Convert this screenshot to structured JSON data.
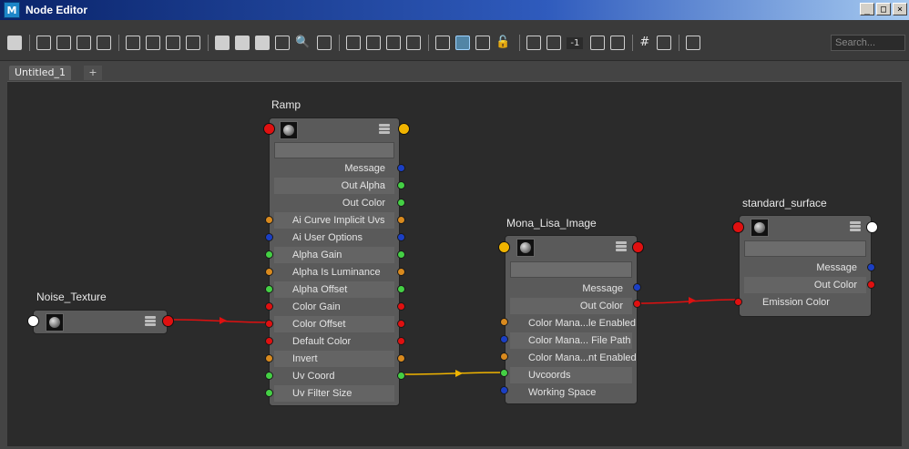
{
  "window": {
    "title": "Node Editor",
    "logo": "M",
    "buttons": [
      "_",
      "□",
      "×"
    ]
  },
  "toolbar": {
    "search_placeholder": "Search...",
    "number_field": "-1",
    "glyphs": {
      "search": "🔍",
      "grid": "#",
      "lock": "🔓"
    }
  },
  "tabs": [
    {
      "label": "Untitled_1",
      "active": true
    },
    {
      "label": "+",
      "active": false
    }
  ],
  "colors": {
    "red": "#e01010",
    "orange": "#d98a1e",
    "green": "#44d044",
    "blue": "#1b3fc4",
    "yellow": "#f0b400",
    "white": "#ffffff",
    "wire_red": "#e01010",
    "wire_yellow": "#f0b400"
  },
  "nodes": {
    "ramp": {
      "title": "Ramp",
      "outputs": [
        "Message",
        "Out Alpha",
        "Out Color"
      ],
      "attributes": [
        "Ai Curve Implicit Uvs",
        "Ai User Options",
        "Alpha Gain",
        "Alpha Is Luminance",
        "Alpha Offset",
        "Color Gain",
        "Color Offset",
        "Default Color",
        "Invert",
        "Uv Coord",
        "Uv Filter Size"
      ]
    },
    "noise": {
      "title": "Noise_Texture"
    },
    "mona": {
      "title": "Mona_Lisa_Image",
      "outputs": [
        "Message",
        "Out Color"
      ],
      "attributes": [
        "Color Mana...le Enabled",
        "Color Mana... File Path",
        "Color Mana...nt Enabled",
        "Uvcoords",
        "Working Space"
      ]
    },
    "surface": {
      "title": "standard_surface",
      "outputs": [
        "Message",
        "Out Color"
      ],
      "attributes": [
        "Emission Color"
      ]
    }
  }
}
